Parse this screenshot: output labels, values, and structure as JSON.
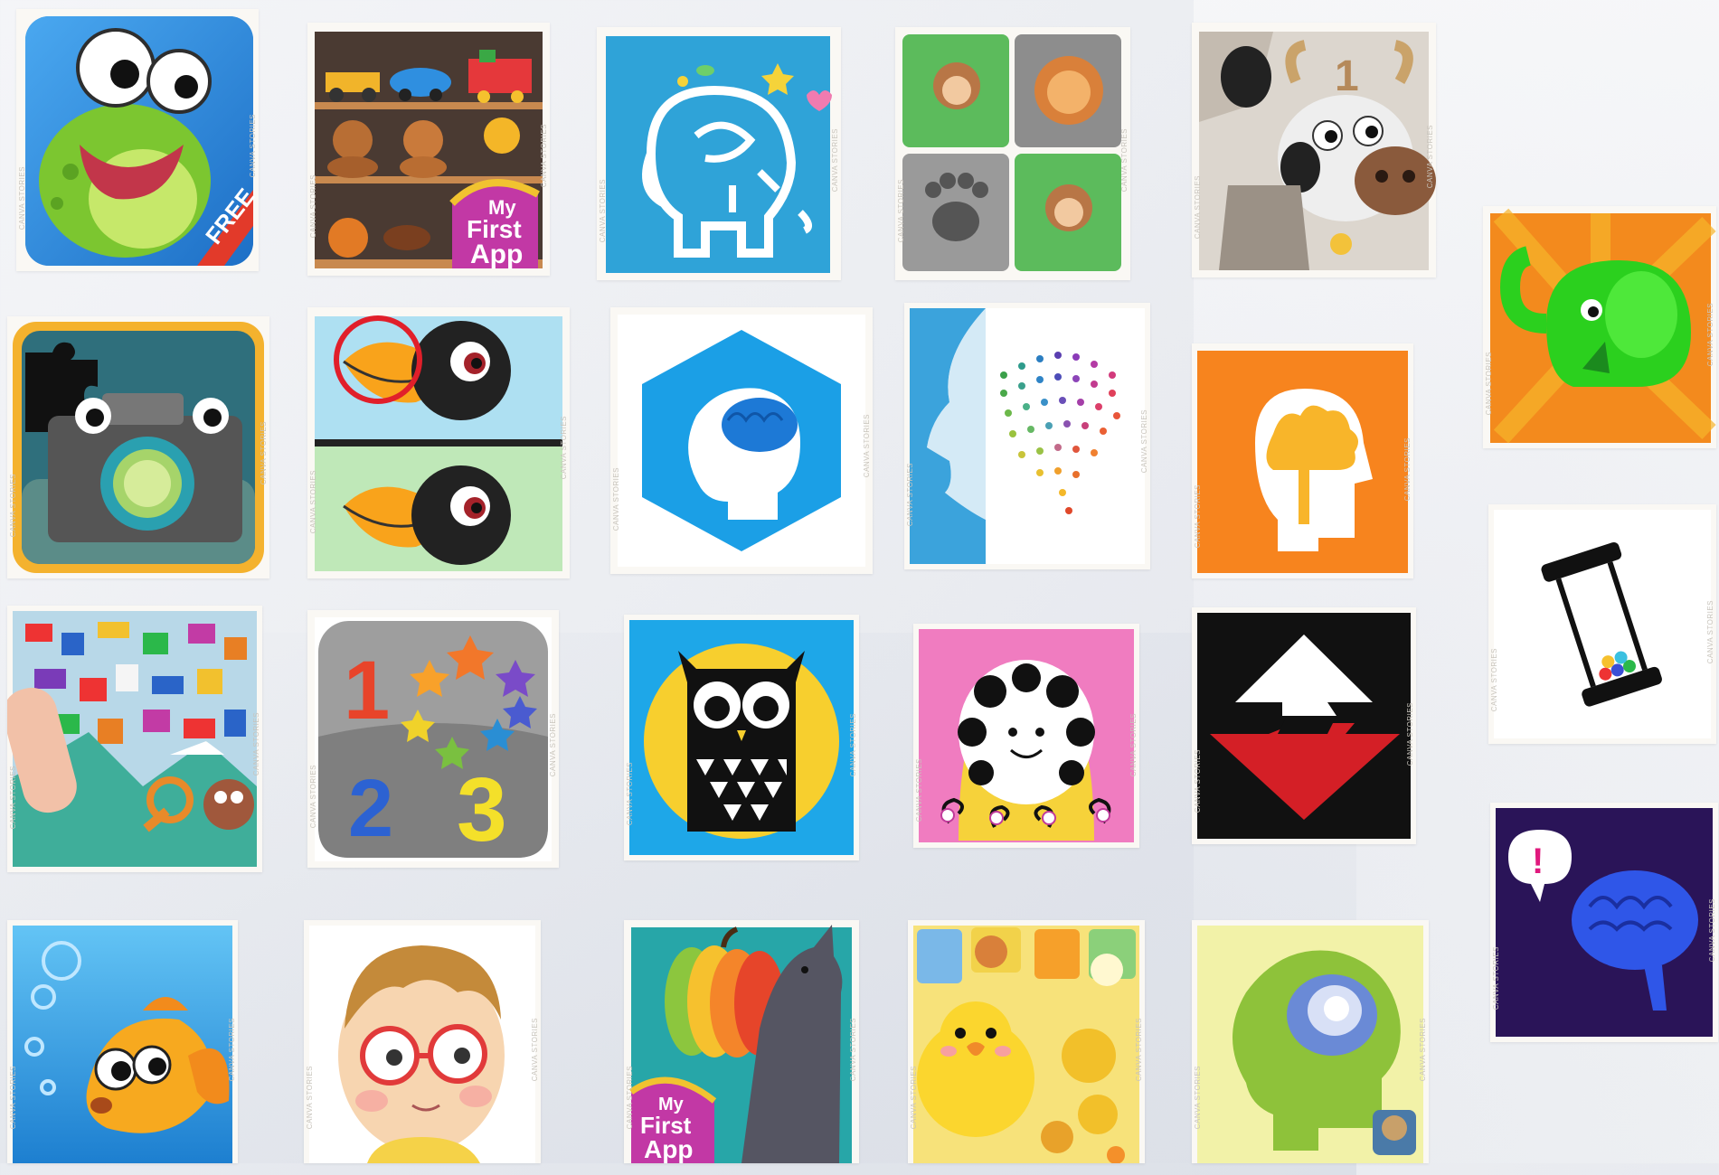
{
  "watermark": "CANVA STORIES",
  "tiles": {
    "frog": {
      "badge": "FREE"
    },
    "toys": {
      "badge_line1": "My",
      "badge_line2": "First",
      "badge_line3": "App"
    },
    "cow": {
      "number": "1"
    },
    "numbers": {
      "n1": "1",
      "n2": "2",
      "n3": "3"
    },
    "pumpkin": {
      "badge_line1": "My",
      "badge_line2": "First",
      "badge_line3": "App"
    },
    "brain_bubble": {
      "mark": "!"
    }
  }
}
